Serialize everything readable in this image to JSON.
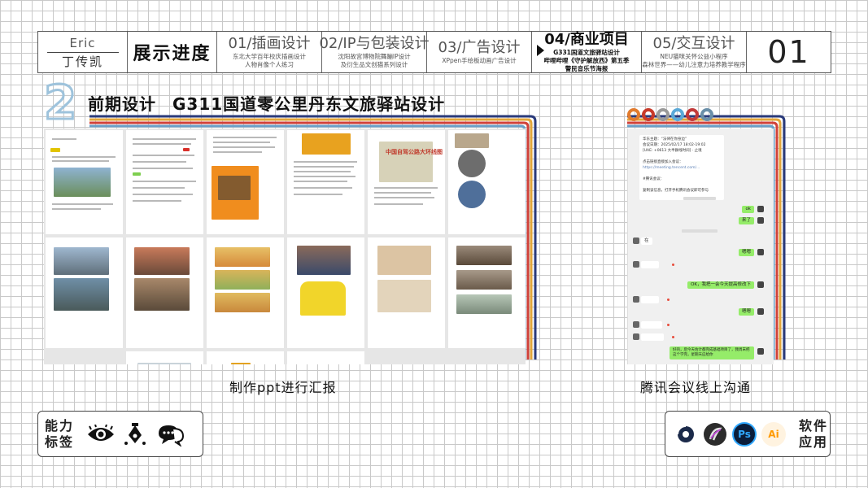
{
  "header": {
    "name_en": "Eric",
    "name_cn": "丁传凯",
    "progress_label": "展示进度",
    "sections": [
      {
        "title": "01/插画设计",
        "sub": [
          "东北大学百年校庆插画设计",
          "人物肖像个人练习"
        ]
      },
      {
        "title": "02/IP与包装设计",
        "sub": [
          "沈阳故宫博物院舞蹦IP设计",
          "及衍生品文创猫系列设计"
        ]
      },
      {
        "title": "03/广告设计",
        "sub": [
          "XPpen手绘板动画广告设计"
        ]
      },
      {
        "title": "04/商业项目",
        "sub": [
          "G331国道文旅驿站设计",
          "哔哩哔哩《守护解放西》第五季",
          "警民音乐节海报"
        ]
      },
      {
        "title": "05/交互设计",
        "sub": [
          "NEU猫咪关怀公益小程序",
          "森林世界——幼儿注意力培养教学程序"
        ]
      }
    ],
    "page_number": "01"
  },
  "heading": {
    "number": "2",
    "phase": "前期设计",
    "project": "G311国道零公里丹东文旅驿站设计"
  },
  "doc_panel": {
    "map_label": "中国自驾公路大环线图"
  },
  "chat": {
    "top_text": [
      "华东主题：“法律在你身边”",
      "会议日期：2025/02/17 18:02-19:02",
      "[UAE: +0613 大半群线时间]  · 止境",
      "",
      "点击链接直接加入会议：",
      "https://meeting.tencent.com/...",
      "",
      "#腾讯会议：",
      "",
      "复制该信息，打开手机腾讯会议即可参与"
    ],
    "messages": [
      {
        "side": "out",
        "text": "ok"
      },
      {
        "side": "out",
        "text": "来了"
      },
      {
        "side": "in",
        "text": "在"
      },
      {
        "side": "out",
        "text": "嗯嗯"
      },
      {
        "side": "out",
        "text": "OK，我把一会今天提高修改下"
      },
      {
        "side": "out",
        "text": "嗯嗯"
      },
      {
        "side": "out",
        "text": "好的，后今天估计都完成基础项目了，我周末把这个学完，星期天应给你"
      }
    ]
  },
  "captions": {
    "left": "制作ppt进行汇报",
    "right": "腾讯会议线上沟通"
  },
  "ability": {
    "label": [
      "能力",
      "标签"
    ],
    "icons": [
      "eye-icon",
      "pen-nib-icon",
      "speech-bubble-icon"
    ]
  },
  "software": {
    "label": [
      "软件",
      "应用"
    ],
    "apps": [
      {
        "icon": "cinema4d-icon",
        "text": "",
        "color": "#1b2a4a"
      },
      {
        "icon": "procreate-icon",
        "text": "",
        "color": "#2c2c2c"
      },
      {
        "icon": "photoshop-icon",
        "text": "Ps",
        "color": "#31a8ff"
      },
      {
        "icon": "illustrator-icon",
        "text": "Ai",
        "color": "#ff9a00"
      }
    ]
  },
  "colors": {
    "stripe": [
      "#2a3a7a",
      "#e2a53a",
      "#d1413a",
      "#6a9fc7"
    ],
    "rings": [
      "#e27b2e",
      "#c83a2a",
      "#9a9a9a",
      "#5aa9d8",
      "#c23a3a",
      "#6a8fa9"
    ]
  }
}
